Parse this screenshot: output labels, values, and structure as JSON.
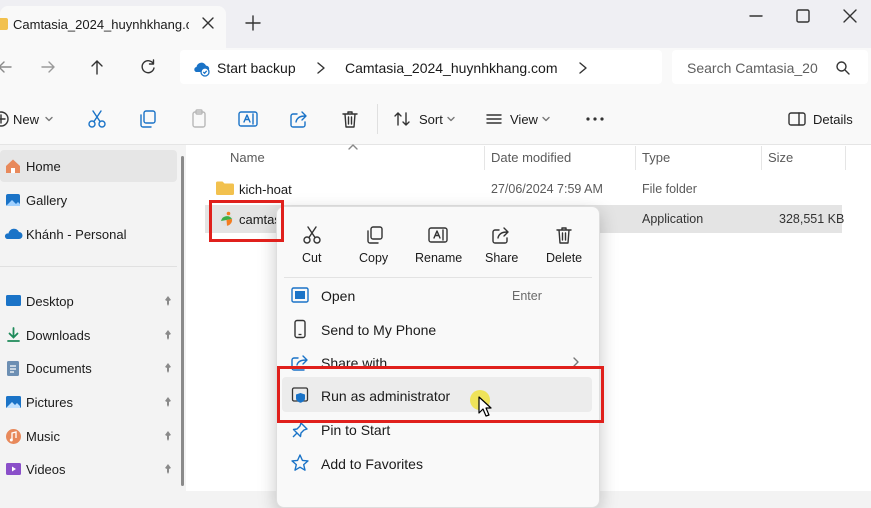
{
  "window": {
    "tab_title": "Camtasia_2024_huynhkhang.c",
    "close_tab_glyph": "✕",
    "new_tab_glyph": "+"
  },
  "addressbar": {
    "backup_label": "Start backup",
    "breadcrumb_current": "Camtasia_2024_huynhkhang.com",
    "search_placeholder": "Search Camtasia_20"
  },
  "toolbar": {
    "new_label": "New",
    "sort_label": "Sort",
    "view_label": "View",
    "details_label": "Details"
  },
  "sidebar": {
    "items": [
      {
        "label": "Home",
        "icon": "home-icon"
      },
      {
        "label": "Gallery",
        "icon": "gallery-icon"
      },
      {
        "label": "Khánh - Personal",
        "icon": "onedrive-cloud-icon"
      },
      {
        "label": "Desktop",
        "icon": "desktop-icon"
      },
      {
        "label": "Downloads",
        "icon": "downloads-icon"
      },
      {
        "label": "Documents",
        "icon": "documents-icon"
      },
      {
        "label": "Pictures",
        "icon": "pictures-icon"
      },
      {
        "label": "Music",
        "icon": "music-icon"
      },
      {
        "label": "Videos",
        "icon": "videos-icon"
      }
    ]
  },
  "files": {
    "columns": [
      "Name",
      "Date modified",
      "Type",
      "Size"
    ],
    "rows": [
      {
        "name": "kich-hoat",
        "date": "27/06/2024 7:59 AM",
        "type": "File folder",
        "size": ""
      },
      {
        "name": "camtas",
        "date": "",
        "type": "Application",
        "size": "328,551 KB"
      }
    ]
  },
  "context_menu": {
    "top_actions": [
      "Cut",
      "Copy",
      "Rename",
      "Share",
      "Delete"
    ],
    "items": [
      {
        "label": "Open",
        "shortcut": "Enter"
      },
      {
        "label": "Send to My Phone"
      },
      {
        "label": "Share with"
      },
      {
        "label": "Run as administrator"
      },
      {
        "label": "Pin to Start"
      },
      {
        "label": "Add to Favorites"
      }
    ]
  },
  "colors": {
    "highlight_border": "#e0201c",
    "folder": "#f2c14e",
    "accent_blue": "#1a73c7"
  }
}
